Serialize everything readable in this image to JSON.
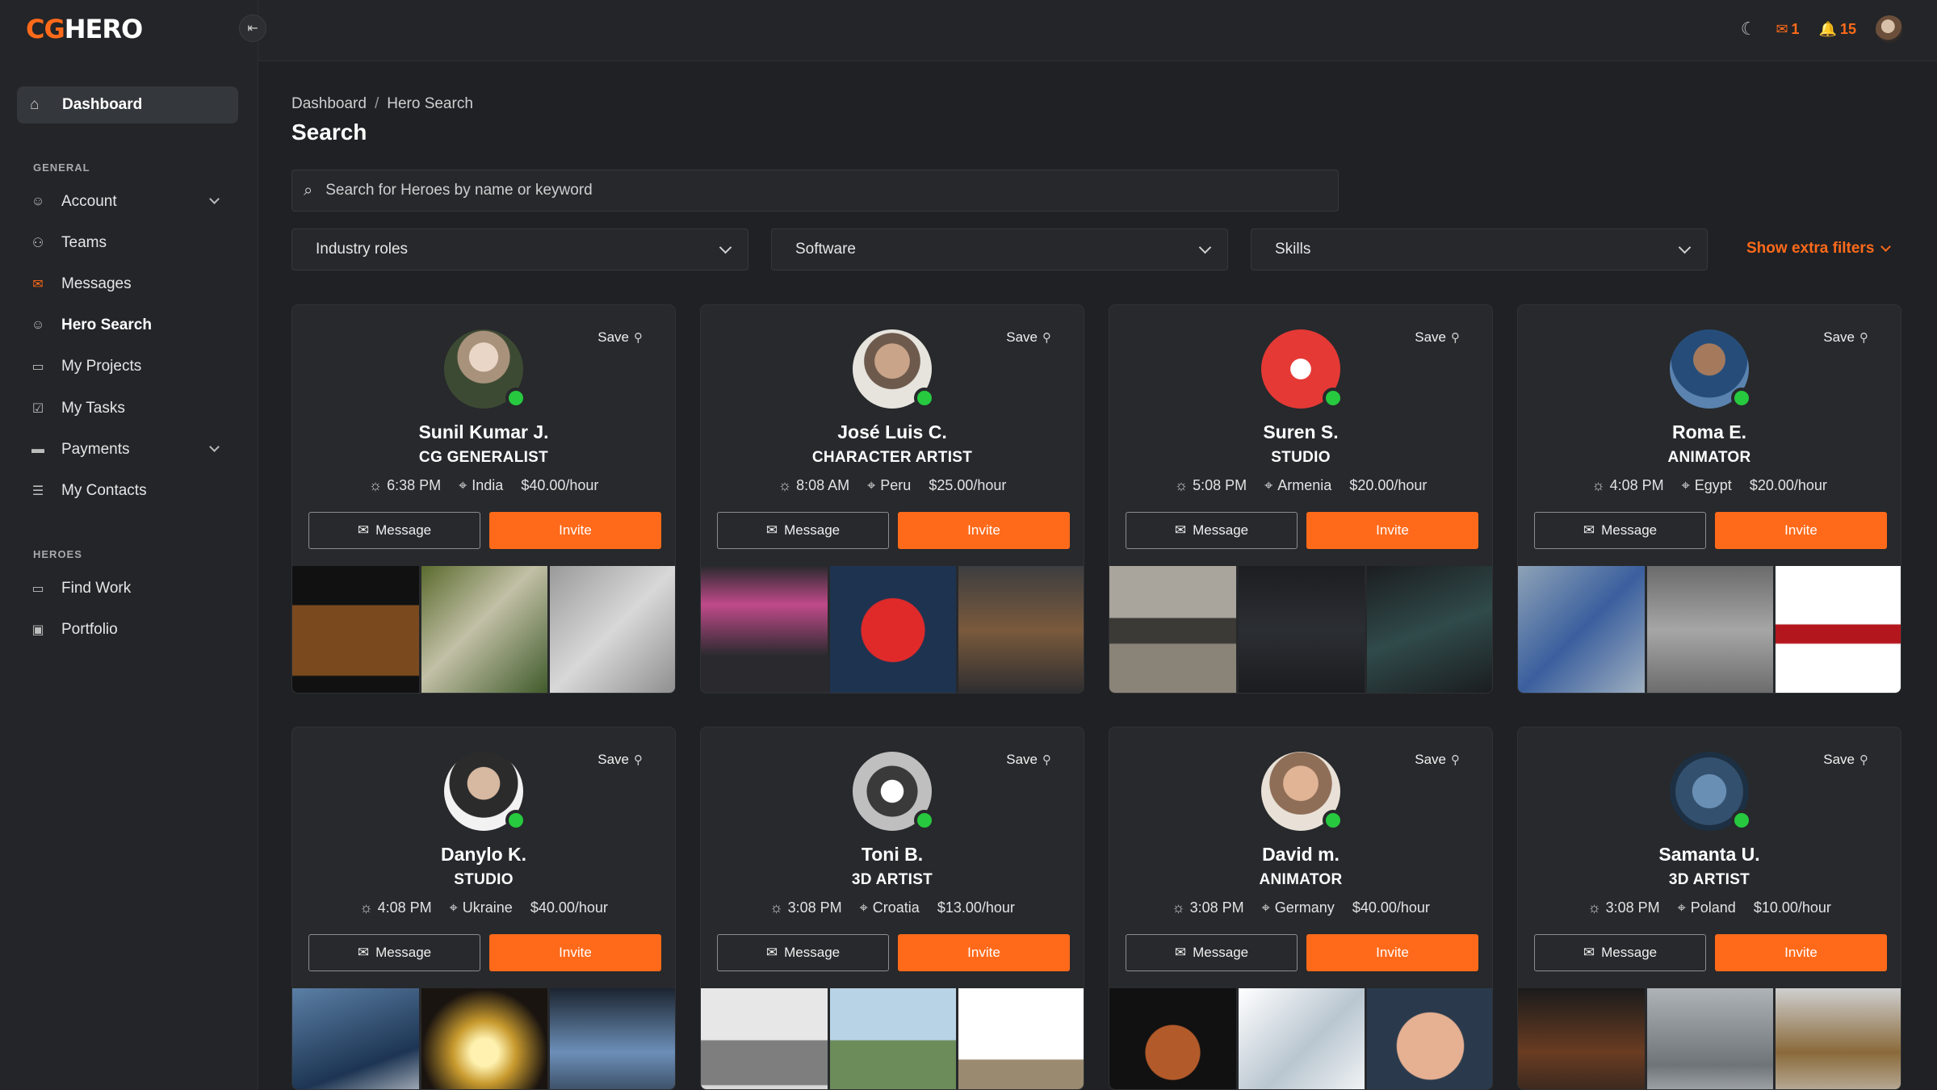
{
  "logo": {
    "cg": "CG",
    "hero": "HERO"
  },
  "sidebar": {
    "dashboard": "Dashboard",
    "general_label": "GENERAL",
    "general_items": [
      {
        "label": "Account",
        "icon": "user-icon",
        "has_chevron": true
      },
      {
        "label": "Teams",
        "icon": "team-icon"
      },
      {
        "label": "Messages",
        "icon": "envelope-icon"
      },
      {
        "label": "Hero Search",
        "icon": "user-search-icon",
        "active": true
      },
      {
        "label": "My Projects",
        "icon": "folder-icon"
      },
      {
        "label": "My Tasks",
        "icon": "checkbox-icon"
      },
      {
        "label": "Payments",
        "icon": "credit-card-icon",
        "has_chevron": true
      },
      {
        "label": "My Contacts",
        "icon": "contacts-icon"
      }
    ],
    "heroes_label": "HEROES",
    "heroes_items": [
      {
        "label": "Find Work",
        "icon": "folder-icon"
      },
      {
        "label": "Portfolio",
        "icon": "image-icon"
      }
    ]
  },
  "topbar": {
    "messages_count": "1",
    "notifications_count": "15"
  },
  "breadcrumb": {
    "root": "Dashboard",
    "current": "Hero Search"
  },
  "page_title": "Search",
  "search": {
    "placeholder": "Search for Heroes by name or keyword"
  },
  "filters": {
    "industry_roles": "Industry roles",
    "software": "Software",
    "skills": "Skills",
    "extra": "Show extra filters"
  },
  "card_labels": {
    "save": "Save",
    "message": "Message",
    "invite": "Invite"
  },
  "heroes": [
    {
      "name": "Sunil Kumar J.",
      "role": "CG GENERALIST",
      "time": "6:38 PM",
      "country": "India",
      "rate": "$40.00/hour"
    },
    {
      "name": "José Luis C.",
      "role": "CHARACTER ARTIST",
      "time": "8:08 AM",
      "country": "Peru",
      "rate": "$25.00/hour"
    },
    {
      "name": "Suren S.",
      "role": "STUDIO",
      "time": "5:08 PM",
      "country": "Armenia",
      "rate": "$20.00/hour"
    },
    {
      "name": "Roma E.",
      "role": "ANIMATOR",
      "time": "4:08 PM",
      "country": "Egypt",
      "rate": "$20.00/hour"
    },
    {
      "name": "Danylo K.",
      "role": "STUDIO",
      "time": "4:08 PM",
      "country": "Ukraine",
      "rate": "$40.00/hour"
    },
    {
      "name": "Toni B.",
      "role": "3D ARTIST",
      "time": "3:08 PM",
      "country": "Croatia",
      "rate": "$13.00/hour"
    },
    {
      "name": "David m.",
      "role": "ANIMATOR",
      "time": "3:08 PM",
      "country": "Germany",
      "rate": "$40.00/hour"
    },
    {
      "name": "Samanta U.",
      "role": "3D ARTIST",
      "time": "3:08 PM",
      "country": "Poland",
      "rate": "$10.00/hour"
    }
  ],
  "colors": {
    "accent": "#ff6a1a",
    "online": "#27c93f",
    "background": "#1f2124"
  }
}
